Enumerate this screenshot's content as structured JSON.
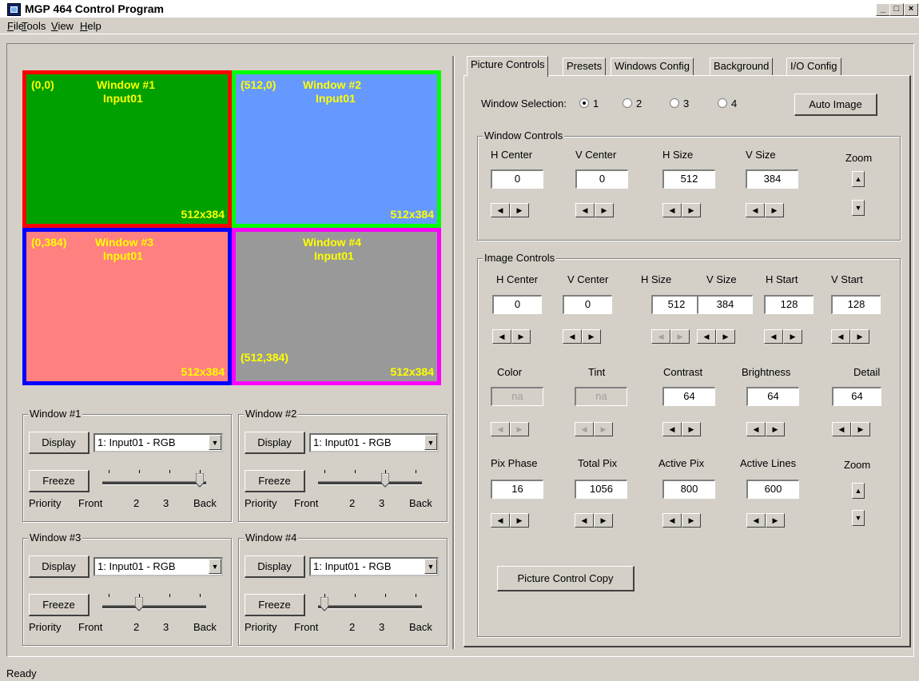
{
  "app": {
    "title": "MGP 464 Control Program",
    "minimize_glyph": "_",
    "maximize_glyph": "□",
    "close_glyph": "×"
  },
  "menu": [
    "File",
    "Tools",
    "View",
    "Help"
  ],
  "preview": {
    "windows": [
      {
        "coords": "(0,0)",
        "name": "Window #1",
        "input": "Input01",
        "size": "512x384",
        "fill": "#00a000",
        "border": "#ff0000"
      },
      {
        "coords": "(512,0)",
        "name": "Window #2",
        "input": "Input01",
        "size": "512x384",
        "fill": "#6699ff",
        "border": "#00ff00"
      },
      {
        "coords": "(0,384)",
        "name": "Window #3",
        "input": "Input01",
        "size": "512x384",
        "fill": "#ff8080",
        "border": "#0000ff"
      },
      {
        "coords": "(512,384)",
        "name": "Window #4",
        "input": "Input01",
        "size": "512x384",
        "fill": "#999999",
        "border": "#ff00ff"
      }
    ]
  },
  "window_groups": [
    {
      "title": "Window #1",
      "display": "Display",
      "input": "1: Input01 - RGB",
      "freeze": "Freeze",
      "priority_level": 4
    },
    {
      "title": "Window #2",
      "display": "Display",
      "input": "1: Input01 - RGB",
      "freeze": "Freeze",
      "priority_level": 3
    },
    {
      "title": "Window #3",
      "display": "Display",
      "input": "1: Input01 - RGB",
      "freeze": "Freeze",
      "priority_level": 2
    },
    {
      "title": "Window #4",
      "display": "Display",
      "input": "1: Input01 - RGB",
      "freeze": "Freeze",
      "priority_level": 1
    }
  ],
  "priority_labels": {
    "priority": "Priority",
    "front": "Front",
    "two": "2",
    "three": "3",
    "back": "Back"
  },
  "tabs": [
    "Picture Controls",
    "Presets",
    "Windows Config",
    "Background",
    "I/O Config"
  ],
  "window_selection": {
    "label": "Window Selection:",
    "options": [
      "1",
      "2",
      "3",
      "4"
    ],
    "selected": "1",
    "auto_image": "Auto Image"
  },
  "window_controls": {
    "title": "Window Controls",
    "fields": [
      {
        "label": "H Center",
        "value": "0"
      },
      {
        "label": "V Center",
        "value": "0"
      },
      {
        "label": "H Size",
        "value": "512"
      },
      {
        "label": "V Size",
        "value": "384"
      }
    ],
    "zoom": "Zoom"
  },
  "image_controls": {
    "title": "Image Controls",
    "row1": [
      {
        "label": "H Center",
        "value": "0"
      },
      {
        "label": "V Center",
        "value": "0"
      },
      {
        "label": "H Size",
        "value": "512"
      },
      {
        "label": "V Size",
        "value": "384"
      },
      {
        "label": "H Start",
        "value": "128"
      },
      {
        "label": "V Start",
        "value": "128"
      }
    ],
    "row2": [
      {
        "label": "Color",
        "value": "na"
      },
      {
        "label": "Tint",
        "value": "na"
      },
      {
        "label": "Contrast",
        "value": "64"
      },
      {
        "label": "Brightness",
        "value": "64"
      },
      {
        "label": "Detail",
        "value": "64"
      }
    ],
    "row3": [
      {
        "label": "Pix Phase",
        "value": "16"
      },
      {
        "label": "Total Pix",
        "value": "1056"
      },
      {
        "label": "Active Pix",
        "value": "800"
      },
      {
        "label": "Active Lines",
        "value": "600"
      }
    ],
    "zoom": "Zoom"
  },
  "copy_button": "Picture Control Copy",
  "status": "Ready"
}
